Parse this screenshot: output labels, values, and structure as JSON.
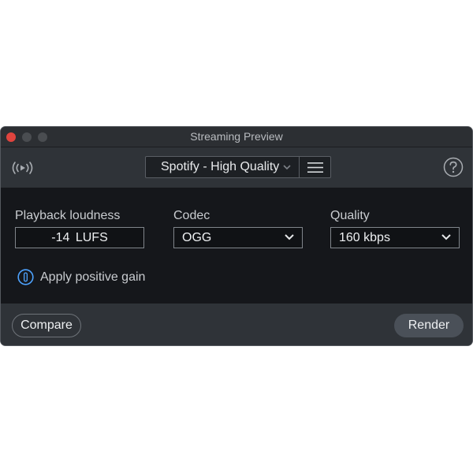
{
  "window": {
    "title": "Streaming Preview"
  },
  "toolbar": {
    "stream_icon": "broadcast-stream-icon",
    "preset": "Spotify - High Quality",
    "menu_icon": "hamburger-menu-icon",
    "help_icon": "help-question-icon"
  },
  "settings": {
    "loudness_label": "Playback loudness",
    "loudness_value": "-14  LUFS",
    "codec_label": "Codec",
    "codec_value": "OGG",
    "quality_label": "Quality",
    "quality_value": "160 kbps",
    "gain_label": "Apply positive gain",
    "gain_enabled": false
  },
  "footer": {
    "compare_label": "Compare",
    "render_label": "Render"
  },
  "colors": {
    "accent": "#4da3ff",
    "close": "#e0443e",
    "background": "#15171b",
    "panel": "#2f3338"
  }
}
